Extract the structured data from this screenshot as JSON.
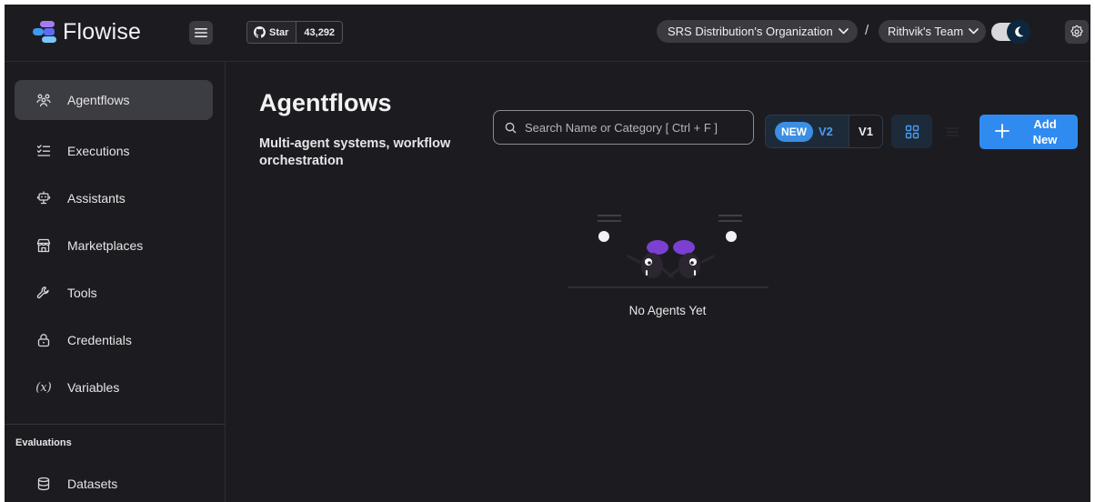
{
  "header": {
    "logo_text": "Flowise",
    "github": {
      "star_label": "Star",
      "star_count": "43,292"
    },
    "organization": "SRS Distribution's Organization",
    "separator": "/",
    "team": "Rithvik's Team"
  },
  "sidebar": {
    "items": [
      {
        "label": "Agentflows",
        "icon": "agentflows-icon",
        "active": true
      },
      {
        "label": "Executions",
        "icon": "executions-list-icon"
      },
      {
        "label": "Assistants",
        "icon": "robot-icon"
      },
      {
        "label": "Marketplaces",
        "icon": "store-icon"
      },
      {
        "label": "Tools",
        "icon": "tool-icon"
      },
      {
        "label": "Credentials",
        "icon": "lock-icon"
      },
      {
        "label": "Variables",
        "icon": "variable-icon",
        "glyph": "(x)"
      }
    ],
    "evaluations_title": "Evaluations",
    "evaluations_items": [
      {
        "label": "Datasets",
        "icon": "database-icon"
      }
    ]
  },
  "main": {
    "title": "Agentflows",
    "description": "Multi-agent systems, workflow orchestration",
    "search_placeholder": "Search Name or Category [ Ctrl + F ]",
    "version_new_badge": "NEW",
    "version_v2": "V2",
    "version_v1": "V1",
    "add_button_label": "Add New",
    "empty_text": "No Agents Yet"
  },
  "colors": {
    "background": "#1c1c20",
    "accent": "#2f8bf0",
    "active_nav": "#3c3c43",
    "robot_head": "#7b3fd1"
  }
}
